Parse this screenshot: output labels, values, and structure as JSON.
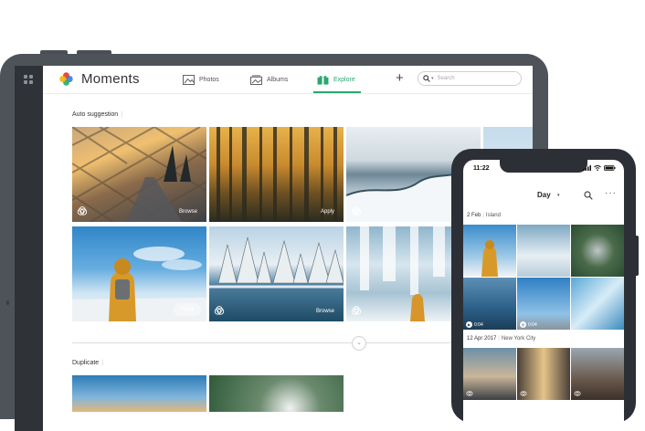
{
  "tablet": {
    "app_title": "Moments",
    "tabs": [
      {
        "label": "Photos",
        "icon": "photo-icon"
      },
      {
        "label": "Albums",
        "icon": "album-icon"
      },
      {
        "label": "Explore",
        "icon": "gift-icon"
      }
    ],
    "active_tab": "Explore",
    "add_label": "+",
    "search_placeholder": "Search",
    "auto_suggestion": {
      "title": "Auto suggestion",
      "photos": [
        {
          "subject": "fence-highway-sunset",
          "action": "Browse"
        },
        {
          "subject": "autumn-forest",
          "action": "Apply"
        },
        {
          "subject": "frozen-shore"
        },
        {
          "subject": "hiker-snow-sky",
          "action": "Apply"
        },
        {
          "subject": "snowy-pine-lake",
          "action": "Browse"
        },
        {
          "subject": "frozen-waterfall-hiker"
        }
      ]
    },
    "duplicate": {
      "title": "Duplicate"
    },
    "accent_color": "#2aa66f"
  },
  "phone": {
    "time": "11:22",
    "view_selector": "Day",
    "groups": [
      {
        "date": "2 Feb",
        "location": "Island",
        "photos": [
          {
            "subject": "hiker-snow"
          },
          {
            "subject": "frozen-waterfall"
          },
          {
            "subject": "winding-road"
          },
          {
            "subject": "ocean-bay",
            "duration": "0:04"
          },
          {
            "subject": "sky-mountain",
            "duration": "0:04"
          },
          {
            "subject": "ice-river"
          }
        ]
      },
      {
        "date": "12 Apr 2017",
        "location": "New York City",
        "photos": [
          {
            "subject": "brooklyn-bridge"
          },
          {
            "subject": "city-street"
          },
          {
            "subject": "manhattan-bridge"
          }
        ]
      }
    ]
  }
}
